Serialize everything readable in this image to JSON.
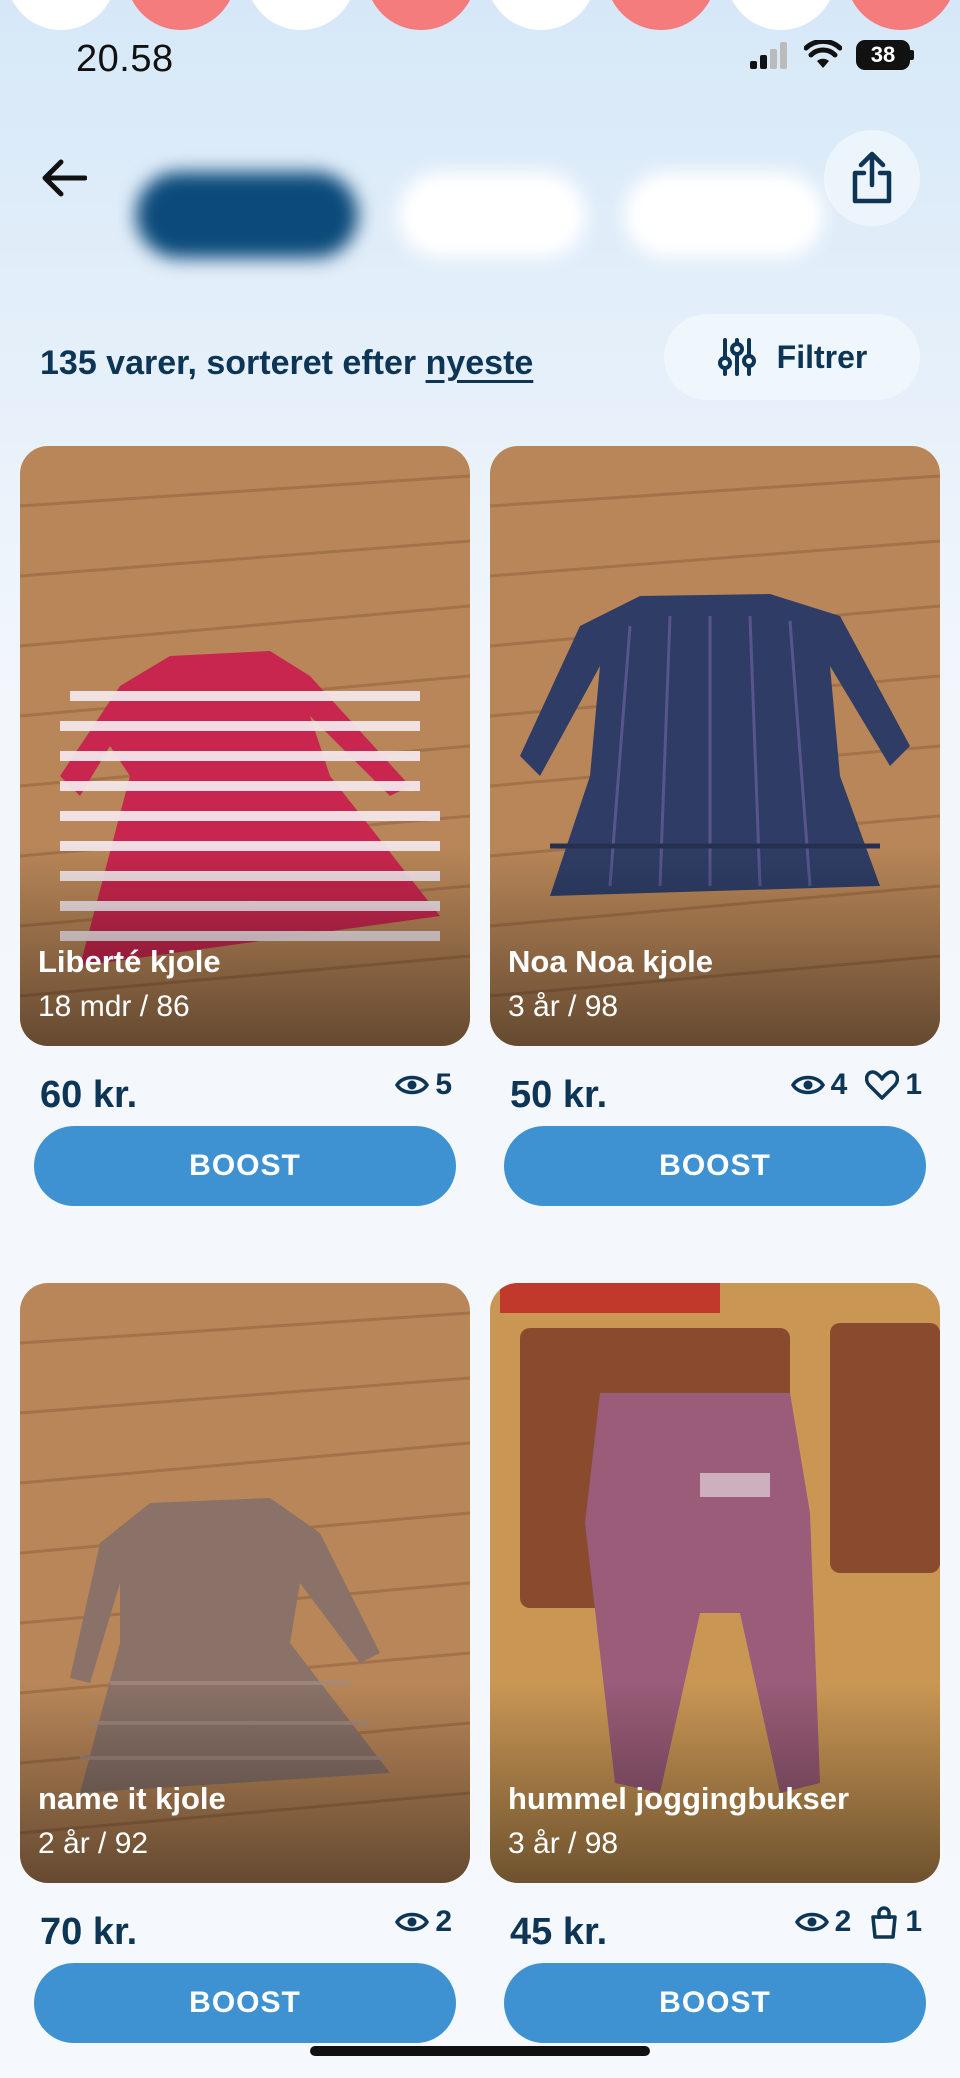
{
  "status_bar": {
    "time": "20.58",
    "battery": "38"
  },
  "header": {
    "tabs": [
      {
        "label": ""
      },
      {
        "label": ""
      },
      {
        "label": ""
      }
    ]
  },
  "summary": {
    "text": "135 varer, sorteret efter ",
    "sort_label": "nyeste",
    "filter_label": "Filtrer"
  },
  "items": [
    {
      "title": "Liberté kjole",
      "size": "18 mdr / 86",
      "price": "60 kr.",
      "views": "5",
      "likes": "",
      "bag": "",
      "boost_label": "BOOST"
    },
    {
      "title": "Noa Noa kjole",
      "size": "3 år / 98",
      "price": "50 kr.",
      "views": "4",
      "likes": "1",
      "bag": "",
      "boost_label": "BOOST"
    },
    {
      "title": "name it kjole",
      "size": "2 år / 92",
      "price": "70 kr.",
      "views": "2",
      "likes": "",
      "bag": "",
      "boost_label": "BOOST"
    },
    {
      "title": "hummel joggingbukser",
      "size": "3 år / 98",
      "price": "45 kr.",
      "views": "2",
      "likes": "",
      "bag": "1",
      "boost_label": "BOOST"
    }
  ],
  "colors": {
    "primary_dark": "#0d3556",
    "boost": "#3f92d2",
    "selected_tab": "#0b4a7a",
    "deco_coral": "#f47c7c"
  },
  "icons": [
    "back-arrow-icon",
    "share-icon",
    "filter-sliders-icon",
    "eye-icon",
    "heart-icon",
    "shopping-bag-icon",
    "signal-icon",
    "wifi-icon",
    "battery-icon"
  ]
}
